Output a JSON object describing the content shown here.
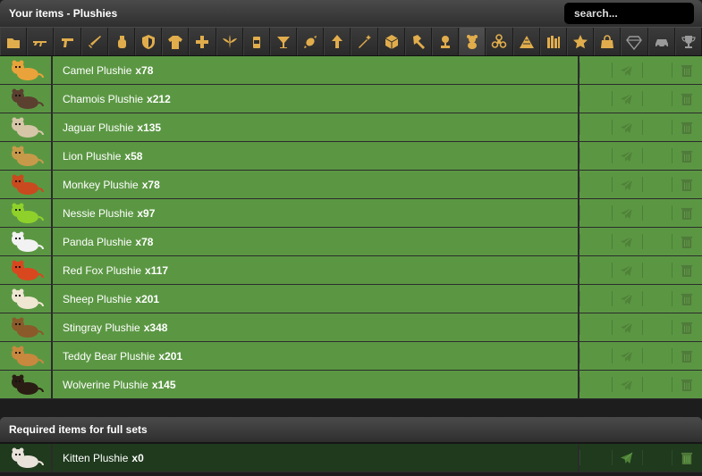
{
  "header": {
    "title": "Your items - Plushies",
    "search_placeholder": "search..."
  },
  "tabs": [
    {
      "icon": "folder-icon"
    },
    {
      "icon": "rifle-icon"
    },
    {
      "icon": "pistol-icon"
    },
    {
      "icon": "sword-icon"
    },
    {
      "icon": "grenade-icon"
    },
    {
      "icon": "shield-icon"
    },
    {
      "icon": "shirt-icon"
    },
    {
      "icon": "medical-cross-icon"
    },
    {
      "icon": "leaf-icon"
    },
    {
      "icon": "can-icon"
    },
    {
      "icon": "cocktail-icon"
    },
    {
      "icon": "candy-icon"
    },
    {
      "icon": "arrow-up-icon"
    },
    {
      "icon": "magic-wand-icon"
    },
    {
      "icon": "box-icon"
    },
    {
      "icon": "hammer-icon"
    },
    {
      "icon": "flower-icon"
    },
    {
      "icon": "teddy-bear-icon",
      "active": true
    },
    {
      "icon": "biohazard-icon"
    },
    {
      "icon": "pyramid-icon"
    },
    {
      "icon": "books-icon"
    },
    {
      "icon": "star-icon"
    },
    {
      "icon": "bag-icon"
    },
    {
      "icon": "diamond-icon"
    },
    {
      "icon": "car-icon"
    },
    {
      "icon": "trophy-icon"
    }
  ],
  "items": [
    {
      "name": "Camel Plushie",
      "qty": "x78",
      "color": "#e9a33a"
    },
    {
      "name": "Chamois Plushie",
      "qty": "x212",
      "color": "#5b4030"
    },
    {
      "name": "Jaguar Plushie",
      "qty": "x135",
      "color": "#d6c6a8"
    },
    {
      "name": "Lion Plushie",
      "qty": "x58",
      "color": "#c79a4a"
    },
    {
      "name": "Monkey Plushie",
      "qty": "x78",
      "color": "#c94a1e"
    },
    {
      "name": "Nessie Plushie",
      "qty": "x97",
      "color": "#8fd12a"
    },
    {
      "name": "Panda Plushie",
      "qty": "x78",
      "color": "#f2f2f2"
    },
    {
      "name": "Red Fox Plushie",
      "qty": "x117",
      "color": "#d9471f"
    },
    {
      "name": "Sheep Plushie",
      "qty": "x201",
      "color": "#efe7d2"
    },
    {
      "name": "Stingray Plushie",
      "qty": "x348",
      "color": "#8a5a2b"
    },
    {
      "name": "Teddy Bear Plushie",
      "qty": "x201",
      "color": "#c8883e"
    },
    {
      "name": "Wolverine Plushie",
      "qty": "x145",
      "color": "#2a1d14"
    }
  ],
  "required": {
    "title": "Required items for full sets",
    "items": [
      {
        "name": "Kitten Plushie",
        "qty": "x0",
        "color": "#e8e2da"
      }
    ]
  }
}
